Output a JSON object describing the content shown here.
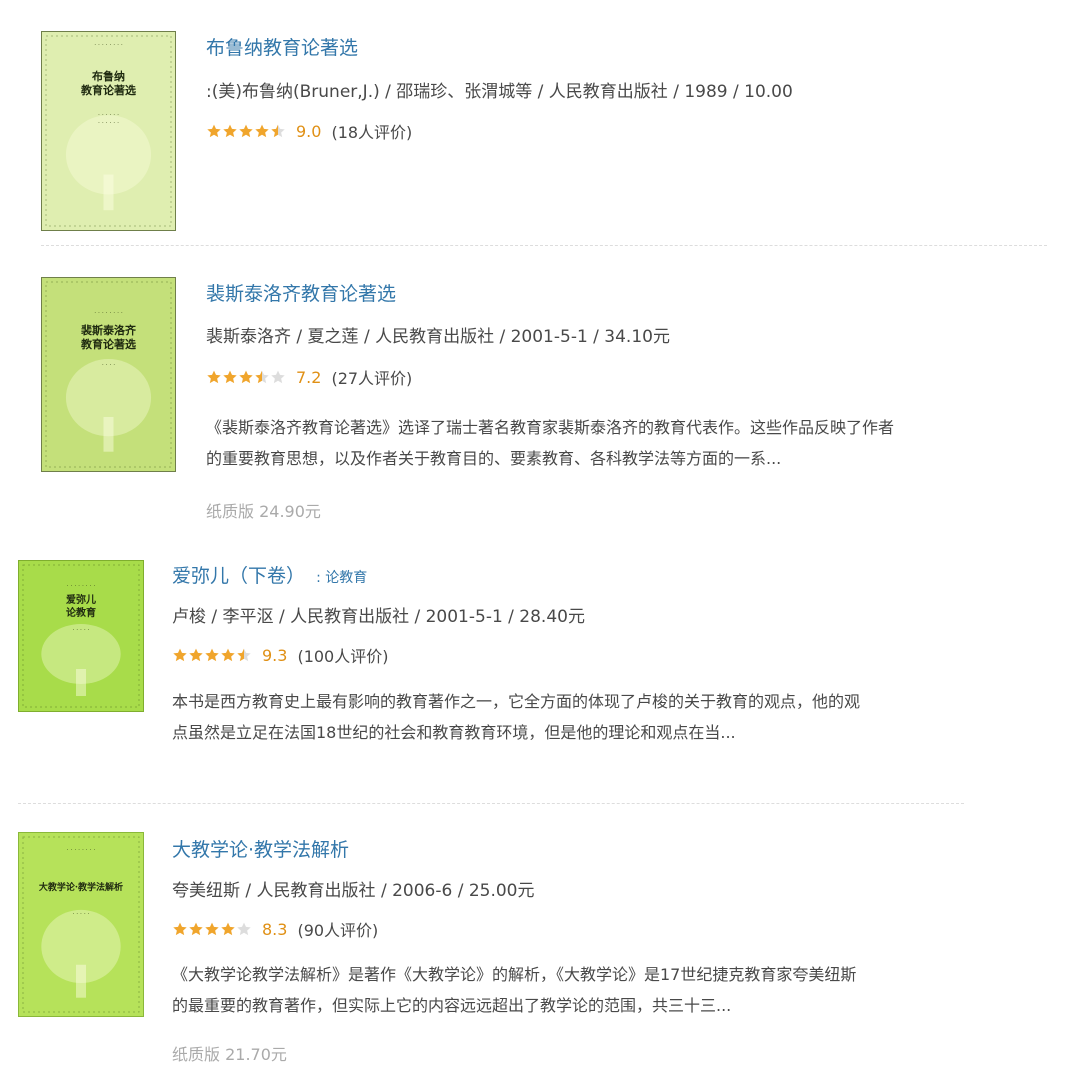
{
  "books": [
    {
      "title": "布鲁纳教育论著选",
      "subtitle": "",
      "meta": ":(美)布鲁纳(Bruner,J.) / 邵瑞珍、张渭城等 / 人民教育出版社 / 1989 / 10.00",
      "rating": 9.0,
      "score_text": "9.0",
      "stars": 4.5,
      "count_text": "(18人评价)",
      "desc_lines": [],
      "paper": "",
      "cover_title": "布鲁纳\n教育论著选",
      "cover_color": "#dfeeb0"
    },
    {
      "title": "裴斯泰洛齐教育论著选",
      "subtitle": "",
      "meta": "裴斯泰洛齐 / 夏之莲 / 人民教育出版社 / 2001-5-1 / 34.10元",
      "rating": 7.2,
      "score_text": "7.2",
      "stars": 3.5,
      "count_text": "(27人评价)",
      "desc_lines": [
        "《裴斯泰洛齐教育论著选》选译了瑞士著名教育家裴斯泰洛齐的教育代表作。这些作品反映了作者",
        "的重要教育思想，以及作者关于教育目的、要素教育、各科教学法等方面的一系..."
      ],
      "paper": "纸质版 24.90元",
      "cover_title": "裴斯泰洛齐\n教育论著选",
      "cover_color": "#c4e07a"
    },
    {
      "title": "爱弥儿（下卷）",
      "subtitle": ": 论教育",
      "meta": "卢梭 / 李平沤 / 人民教育出版社 / 2001-5-1 / 28.40元",
      "rating": 9.3,
      "score_text": "9.3",
      "stars": 4.5,
      "count_text": "(100人评价)",
      "desc_lines": [
        "本书是西方教育史上最有影响的教育著作之一，它全方面的体现了卢梭的关于教育的观点，他的观",
        "点虽然是立足在法国18世纪的社会和教育教育环境，但是他的理论和观点在当..."
      ],
      "paper": "",
      "cover_title": "爱弥儿\n论教育",
      "cover_color": "#a8dc4a"
    },
    {
      "title": "大教学论·教学法解析",
      "subtitle": "",
      "meta": "夸美纽斯 / 人民教育出版社 / 2006-6 / 25.00元",
      "rating": 8.3,
      "score_text": "8.3",
      "stars": 4,
      "count_text": "(90人评价)",
      "desc_lines": [
        "《大教学论教学法解析》是著作《大教学论》的解析，《大教学论》是17世纪捷克教育家夸美纽斯",
        "的最重要的教育著作，但实际上它的内容远远超出了教学论的范围，共三十三..."
      ],
      "paper": "纸质版 21.70元",
      "cover_title": "大教学论·教学法解析",
      "cover_color": "#b6e25a"
    }
  ],
  "colors": {
    "link": "#3377aa",
    "score": "#e09015",
    "star_on": "#f0a52c",
    "star_off": "#dddddd",
    "text": "#494949",
    "muted": "#aaaaaa"
  },
  "icons": {
    "star": "star-icon"
  }
}
